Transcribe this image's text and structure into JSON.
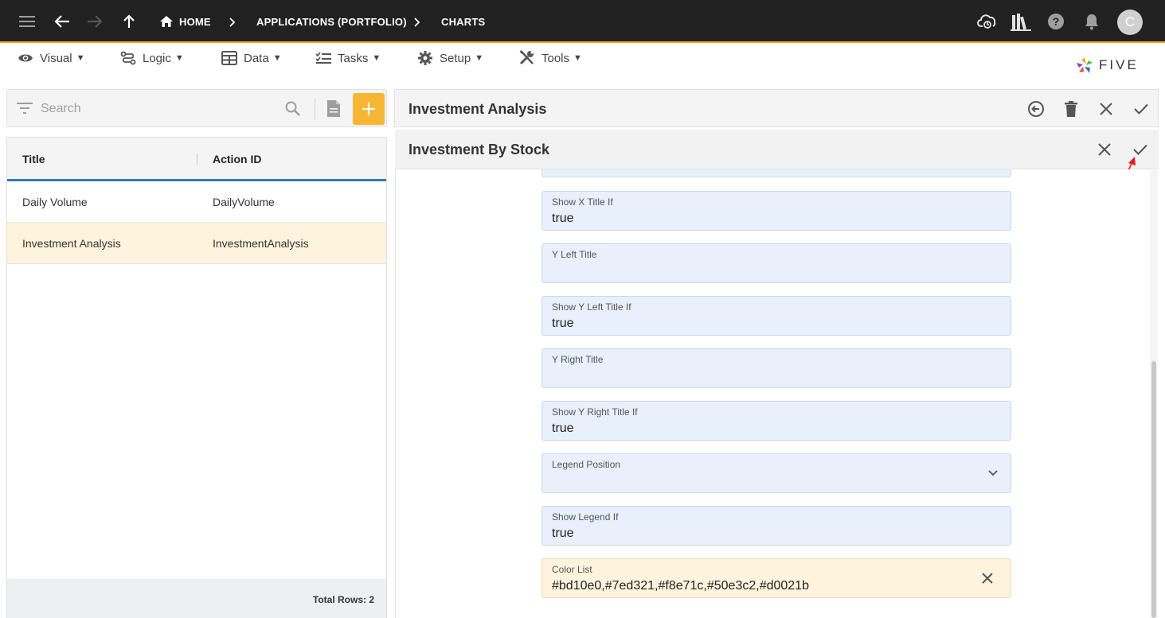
{
  "topbar": {
    "breadcrumbs": [
      {
        "label": "HOME"
      },
      {
        "label": "APPLICATIONS (PORTFOLIO)"
      },
      {
        "label": "CHARTS"
      }
    ],
    "avatar_initial": "C"
  },
  "menu": {
    "items": [
      {
        "label": "Visual"
      },
      {
        "label": "Logic"
      },
      {
        "label": "Data"
      },
      {
        "label": "Tasks"
      },
      {
        "label": "Setup"
      },
      {
        "label": "Tools"
      }
    ],
    "caret": "▼"
  },
  "logo": {
    "text": "FIVE"
  },
  "search": {
    "placeholder": "Search"
  },
  "list": {
    "columns": [
      "Title",
      "Action ID"
    ],
    "rows": [
      {
        "title": "Daily Volume",
        "action_id": "DailyVolume"
      },
      {
        "title": "Investment Analysis",
        "action_id": "InvestmentAnalysis"
      }
    ],
    "footer": "Total Rows: 2"
  },
  "detail": {
    "title": "Investment Analysis",
    "subtitle": "Investment By Stock",
    "fields": [
      {
        "label": "Show X Title If",
        "value": "true"
      },
      {
        "label": "Y Left Title",
        "value": ""
      },
      {
        "label": "Show Y Left Title If",
        "value": "true"
      },
      {
        "label": "Y Right Title",
        "value": ""
      },
      {
        "label": "Show Y Right Title If",
        "value": "true"
      },
      {
        "label": "Legend Position",
        "value": ""
      },
      {
        "label": "Show Legend If",
        "value": "true"
      },
      {
        "label": "Color List",
        "value": "#bd10e0,#7ed321,#f8e71c,#50e3c2,#d0021b"
      }
    ]
  },
  "colors": {
    "topbar": "#212121",
    "accent": "#f5a623",
    "add_button": "#f6b632",
    "header_underline": "#2b7bc4",
    "field_bg": "#e7f0fb",
    "highlight_bg": "#fef3dc",
    "annotation_arrow": "#e02020"
  }
}
